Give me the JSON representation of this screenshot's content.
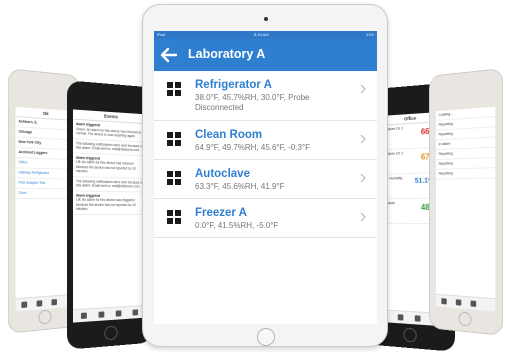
{
  "ipad": {
    "status_left": "iPad",
    "status_time": "8:15 AM",
    "status_right": "41%",
    "nav_title": "Laboratory A",
    "items": [
      {
        "title": "Refrigerator A",
        "subtitle": "38.0°F, 45.7%RH, 30.0°F, Probe Disconnected"
      },
      {
        "title": "Clean Room",
        "subtitle": "64.9°F, 49.7%RH, 45.6°F, -0.3°F"
      },
      {
        "title": "Autoclave",
        "subtitle": "63.3°F, 45.6%RH, 41.9°F"
      },
      {
        "title": "Freezer A",
        "subtitle": "0.0°F, 41.5%RH, -5.0°F"
      }
    ]
  },
  "phone_left": {
    "header": "Dk",
    "items": [
      {
        "title": "Ashburn, IL",
        "sub": ""
      },
      {
        "title": "Chicago",
        "sub": ""
      },
      {
        "title": "New York City",
        "sub": ""
      },
      {
        "title": "Archived Loggers",
        "sub": ""
      },
      {
        "title": "Office",
        "sub": ""
      },
      {
        "title": "Hallway Refrigerator",
        "sub": ""
      },
      {
        "title": "PDE Adapter Test",
        "sub": ""
      },
      {
        "title": "Zone",
        "sub": ""
      }
    ]
  },
  "phone_mid_left": {
    "header": "Events",
    "events": [
      {
        "title": "Alarm triggered",
        "body": "Green: An alarm for this device has returned to normal. The device is now reporting again."
      },
      {
        "title": "",
        "body": "The following notifications were sent because of this alarm: Email sent to: mail@dicksons.com"
      },
      {
        "title": "Alarm triggered",
        "body": "Lift: An alarm for this device has returned because the device has not reported for 20 minutes."
      },
      {
        "title": "",
        "body": "The following notifications were sent because of this alarm: Email sent to: mail@dicksons.com"
      },
      {
        "title": "Alarm triggered",
        "body": "Lift: An alarm for this device was triggered because the device has not reported for 20 minutes."
      },
      {
        "title": "",
        "body": "The following notifications were sent because of this alarm: Email sent to: mail@dicksons.com"
      }
    ]
  },
  "phone_mid_right": {
    "header": "Office",
    "readings": [
      {
        "label": "Temperature Ch 1",
        "value": "66.7°F",
        "color": "#d9342b"
      },
      {
        "label": "Temperature Ch 2",
        "value": "67.6°F",
        "color": "#e8901a"
      },
      {
        "label": "Relative Humidity",
        "value": "51.1%RH",
        "color": "#2f7fd1"
      },
      {
        "label": "Temperature",
        "value": "48.9°F",
        "color": "#3aa24a"
      }
    ]
  },
  "phone_right": {
    "header": "",
    "lines": [
      "Loading...",
      "Reporting",
      "Reporting",
      "In alarm",
      "Reporting",
      "Reporting",
      "Reporting"
    ]
  },
  "colors": {
    "accent": "#2f7fd1",
    "status_bar": "#2e78c7",
    "text_muted": "#777777"
  }
}
